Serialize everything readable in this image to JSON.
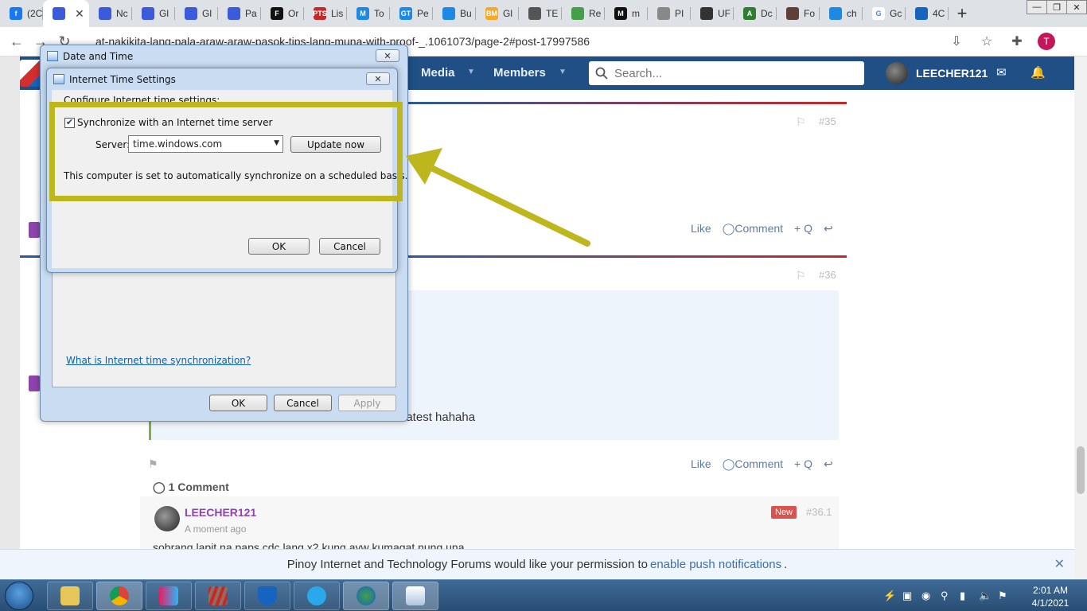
{
  "browser": {
    "tabs": [
      {
        "label": "(2C",
        "color": "#1877f2",
        "glyph": "f"
      },
      {
        "label": "",
        "color": "#3b5bdb",
        "glyph": "",
        "active": true
      },
      {
        "label": "Nc",
        "color": "#3b5bdb",
        "glyph": ""
      },
      {
        "label": "Gl",
        "color": "#3b5bdb",
        "glyph": ""
      },
      {
        "label": "Gl",
        "color": "#3b5bdb",
        "glyph": ""
      },
      {
        "label": "Pa",
        "color": "#3b5bdb",
        "glyph": ""
      },
      {
        "label": "Or",
        "color": "#111111",
        "glyph": "F"
      },
      {
        "label": "Lis",
        "color": "#c62828",
        "glyph": "PTS"
      },
      {
        "label": "To",
        "color": "#1e88e5",
        "glyph": "M"
      },
      {
        "label": "Pe",
        "color": "#1e88e5",
        "glyph": "GT"
      },
      {
        "label": "Bu",
        "color": "#1e88e5",
        "glyph": ""
      },
      {
        "label": "Gl",
        "color": "#f9a825",
        "glyph": "BM"
      },
      {
        "label": "TE",
        "color": "#555555",
        "glyph": ""
      },
      {
        "label": "Re",
        "color": "#43a047",
        "glyph": ""
      },
      {
        "label": "m",
        "color": "#111111",
        "glyph": "M"
      },
      {
        "label": "PI",
        "color": "#888888",
        "glyph": ""
      },
      {
        "label": "UF",
        "color": "#333333",
        "glyph": ""
      },
      {
        "label": "Dc",
        "color": "#2e7d32",
        "glyph": "A"
      },
      {
        "label": "Fo",
        "color": "#5d4037",
        "glyph": ""
      },
      {
        "label": "ch",
        "color": "#1e88e5",
        "glyph": ""
      },
      {
        "label": "Gc",
        "color": "#ffffff",
        "glyph": "G"
      },
      {
        "label": "4C",
        "color": "#1565c0",
        "glyph": ""
      }
    ],
    "url": "at-nakikita-lang-pala-araw-araw-pasok-tips-lang-muna-with-proof-_.1061073/page-2#post-17997586",
    "profile_initial": "T"
  },
  "site": {
    "nav": [
      "Media",
      "Members"
    ],
    "search_placeholder": "Search...",
    "username": "LEECHER121"
  },
  "posts": [
    {
      "number": "#35",
      "actions": [
        "Like",
        "Comment",
        "+ Q"
      ]
    },
    {
      "number": "#36",
      "actions": [
        "Like",
        "Comment",
        "+ Q"
      ],
      "quote_fragment": "li ko matest hahaha"
    }
  ],
  "comments": {
    "count_label": "1 Comment",
    "items": [
      {
        "author": "LEECHER121",
        "time": "A moment ago",
        "badge": "New",
        "number": "#36.1",
        "text": "sobrang lapit na paps cdc lang x2 kung ayw kumagat nung una"
      }
    ]
  },
  "push_banner": {
    "text_before": "Pinoy Internet and Technology Forums would like your permission to",
    "link": "enable push notifications",
    "text_after": "."
  },
  "date_time_dialog": {
    "title": "Date and Time",
    "link": "What is Internet time synchronization?",
    "buttons": {
      "ok": "OK",
      "cancel": "Cancel",
      "apply": "Apply"
    }
  },
  "internet_time_dialog": {
    "title": "Internet Time Settings",
    "heading": "Configure Internet time settings:",
    "sync_label": "Synchronize with an Internet time server",
    "sync_checked": true,
    "server_label": "Server:",
    "server_value": "time.windows.com",
    "update_button": "Update now",
    "status": "This computer is set to automatically synchronize on a scheduled basis.",
    "buttons": {
      "ok": "OK",
      "cancel": "Cancel"
    }
  },
  "annotation": {
    "color": "#bdb61c"
  },
  "taskbar": {
    "time": "2:01 AM",
    "date": "4/1/2021"
  }
}
